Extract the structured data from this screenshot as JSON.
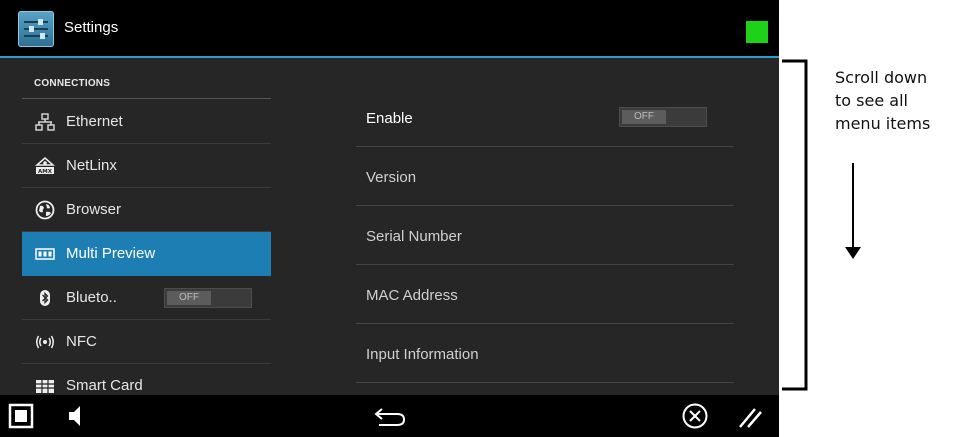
{
  "titlebar": {
    "title": "Settings",
    "icon": "settings-sliders-icon",
    "status_color": "#1ed21a"
  },
  "menu": {
    "header": "CONNECTIONS",
    "items": [
      {
        "label": "Ethernet",
        "icon": "ethernet-icon"
      },
      {
        "label": "NetLinx",
        "icon": "netlinx-icon"
      },
      {
        "label": "Browser",
        "icon": "browser-icon"
      },
      {
        "label": "Multi Preview",
        "icon": "multi-preview-icon",
        "active": true
      },
      {
        "label": "Blueto..",
        "icon": "bluetooth-icon",
        "toggle": "OFF"
      },
      {
        "label": "NFC",
        "icon": "nfc-icon"
      },
      {
        "label": "Smart Card",
        "icon": "smart-card-icon"
      }
    ]
  },
  "panel": {
    "rows": [
      {
        "label": "Enable",
        "toggle": "OFF"
      },
      {
        "label": "Version"
      },
      {
        "label": "Serial Number"
      },
      {
        "label": "MAC Address"
      },
      {
        "label": "Input Information"
      }
    ]
  },
  "navbar": {
    "icons": [
      "window-icon",
      "speaker-icon",
      "back-icon",
      "close-circle-icon",
      "resize-grip-icon"
    ]
  },
  "annotation": {
    "lines": [
      "Scroll down",
      "to see all",
      "menu items"
    ]
  },
  "colors": {
    "accent": "#2a9fd0",
    "active_item": "#1d7eb3",
    "content_bg": "#262626"
  }
}
